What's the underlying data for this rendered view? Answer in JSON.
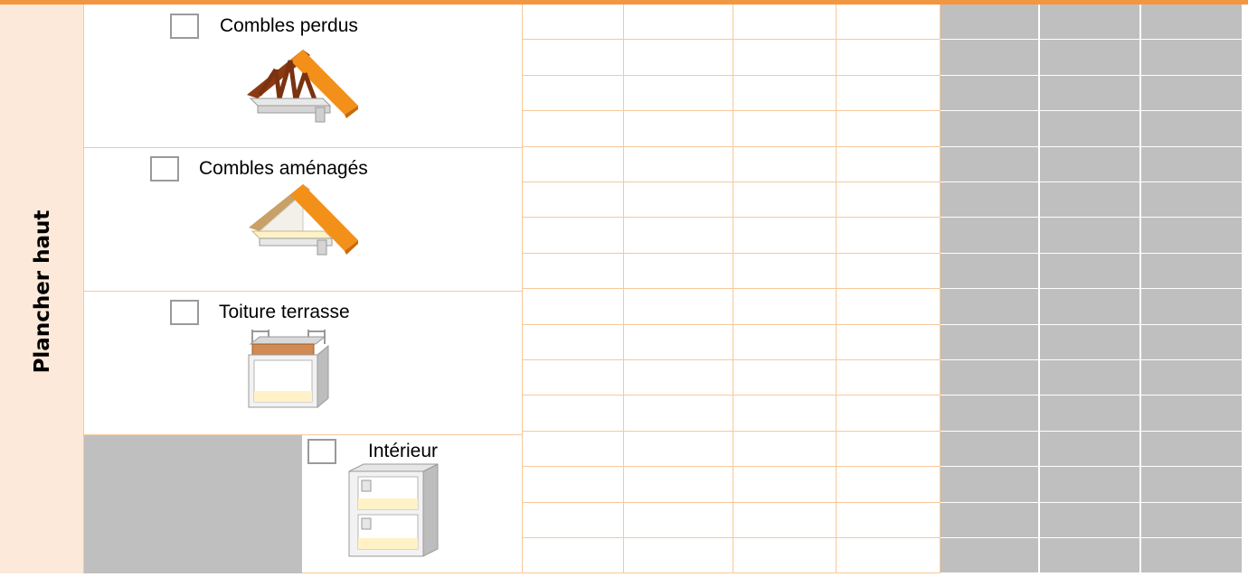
{
  "section": {
    "label": "Plancher haut"
  },
  "rows": [
    {
      "label": "Combles perdus",
      "icon": "attic-unconverted-icon"
    },
    {
      "label": "Combles aménagés",
      "icon": "attic-converted-icon"
    },
    {
      "label": "Toiture terrasse",
      "icon": "flat-roof-icon"
    },
    {
      "label": "Intérieur",
      "icon": "interior-floor-icon"
    }
  ],
  "colors": {
    "accent_orange": "#f29641",
    "roof_orange": "#f39019",
    "label_bg": "#fde9d9",
    "grid_line": "#f7c89a",
    "shaded_cell": "#bfbfbf",
    "floor_cream": "#fff2c6",
    "beam_brown": "#8b3a12"
  }
}
